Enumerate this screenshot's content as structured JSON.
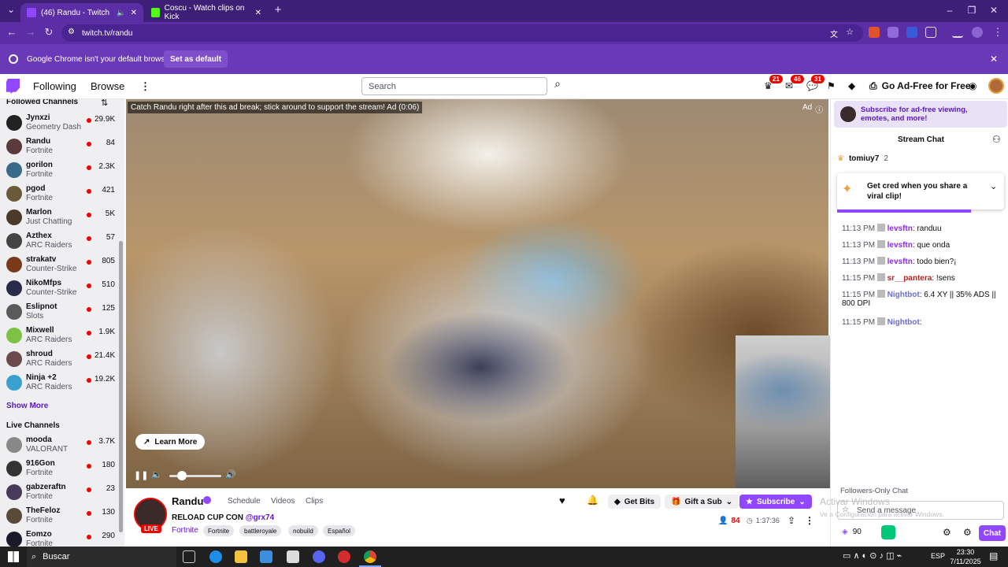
{
  "browser": {
    "tabs": [
      {
        "title": "(46) Randu - Twitch",
        "active": true
      },
      {
        "title": "Coscu - Watch clips on Kick",
        "active": false
      }
    ],
    "new_tab": "+",
    "url": "twitch.tv/randu",
    "infobar": {
      "message": "Google Chrome isn't your default browser",
      "action": "Set as default"
    }
  },
  "twitch": {
    "nav": {
      "following": "Following",
      "browse": "Browse",
      "more": "⋮"
    },
    "search": {
      "placeholder": "Search"
    },
    "badges": [
      "21",
      "46",
      "31"
    ],
    "ad_free": "Go Ad-Free for Free"
  },
  "sidebar": {
    "followed_title": "Followed Channels",
    "followed": [
      {
        "name": "Jynxzi",
        "game": "Geometry Dash",
        "viewers": "29.9K",
        "color": "#222"
      },
      {
        "name": "Randu",
        "game": "Fortnite",
        "viewers": "84",
        "color": "#5a3a3a"
      },
      {
        "name": "gorilon",
        "game": "Fortnite",
        "viewers": "2.3K",
        "color": "#3a6a8a"
      },
      {
        "name": "pgod",
        "game": "Fortnite",
        "viewers": "421",
        "color": "#6a5a3a"
      },
      {
        "name": "Marlon",
        "game": "Just Chatting",
        "viewers": "5K",
        "color": "#4a3a2a"
      },
      {
        "name": "Azthex",
        "game": "ARC Raiders",
        "viewers": "57",
        "color": "#444"
      },
      {
        "name": "strakatv",
        "game": "Counter-Strike",
        "viewers": "805",
        "color": "#7a3a1a"
      },
      {
        "name": "NikoMfps",
        "game": "Counter-Strike",
        "viewers": "510",
        "color": "#2a2a4a"
      },
      {
        "name": "Eslipnot",
        "game": "Slots",
        "viewers": "125",
        "color": "#5a5a5a"
      },
      {
        "name": "Mixwell",
        "game": "ARC Raiders",
        "viewers": "1.9K",
        "color": "#7dc242"
      },
      {
        "name": "shroud",
        "game": "ARC Raiders",
        "viewers": "21.4K",
        "color": "#6a4a4a"
      },
      {
        "name": "Ninja +2",
        "game": "ARC Raiders",
        "viewers": "19.2K",
        "color": "#3aa0d0"
      }
    ],
    "show_more": "Show More",
    "live_title": "Live Channels",
    "live": [
      {
        "name": "mooda",
        "game": "VALORANT",
        "viewers": "3.7K",
        "color": "#888"
      },
      {
        "name": "916Gon",
        "game": "Fortnite",
        "viewers": "180",
        "color": "#333"
      },
      {
        "name": "gabzeraftn",
        "game": "Fortnite",
        "viewers": "23",
        "color": "#4a3a5a"
      },
      {
        "name": "TheFeloz",
        "game": "Fortnite",
        "viewers": "130",
        "color": "#5a4a3a"
      },
      {
        "name": "Eomzo",
        "game": "Fortnite",
        "viewers": "290",
        "color": "#1a1a2a"
      }
    ]
  },
  "player": {
    "ad_banner": "Catch Randu right after this ad break; stick around to support the stream! Ad (0:06)",
    "ad_label": "Ad",
    "learn_more": "Learn More",
    "volume": 0.2
  },
  "stream": {
    "channel": "Randu",
    "tabs": [
      "Schedule",
      "Videos",
      "Clips"
    ],
    "title_prefix": "RELOAD CUP CON",
    "title_mention": "@grx74",
    "live": "LIVE",
    "game": "Fortnite",
    "tags": [
      "Fortnite",
      "battleroyale",
      "nobuild",
      "Español"
    ],
    "viewers": "84",
    "uptime": "1:37:36",
    "get_bits": "Get Bits",
    "gift_sub": "Gift a Sub",
    "subscribe": "Subscribe"
  },
  "chat": {
    "promo": "Subscribe for ad-free viewing, emotes, and more!",
    "header": "Stream Chat",
    "pinned_user": "tomiuy7",
    "pinned_count": "2",
    "cred_popup": "Get cred when you share a viral clip!",
    "messages": [
      {
        "time": "11:13 PM",
        "user": "levsftn",
        "text": "randuu",
        "ucls": "u1"
      },
      {
        "time": "11:13 PM",
        "user": "levsftn",
        "text": "que onda",
        "ucls": "u1"
      },
      {
        "time": "11:13 PM",
        "user": "levsftn",
        "text": "todo bien?¡",
        "ucls": "u1"
      },
      {
        "time": "11:15 PM",
        "user": "sr__pantera",
        "text": "!sens",
        "ucls": "u2"
      },
      {
        "time": "11:15 PM",
        "user": "Nightbot",
        "text": "6.4 XY || 35% ADS || 800 DPI",
        "ucls": "u3"
      },
      {
        "time": "11:15 PM",
        "user": "Nightbot",
        "text": "",
        "ucls": "u3"
      }
    ],
    "followers_only": "Followers-Only Chat",
    "send_placeholder": "Send a message",
    "points": "90",
    "chat_button": "Chat",
    "watermark1": "Activar Windows",
    "watermark2": "Ve a Configuración para activar Windows."
  },
  "taskbar": {
    "search": "Buscar",
    "lang": "ESP",
    "time": "23:30",
    "date": "7/11/2025"
  },
  "colors": {
    "twitch_purple": "#9147ff",
    "live_red": "#eb0400",
    "chrome_dark": "#3d1f78",
    "chrome_mid": "#5b2ea6"
  }
}
